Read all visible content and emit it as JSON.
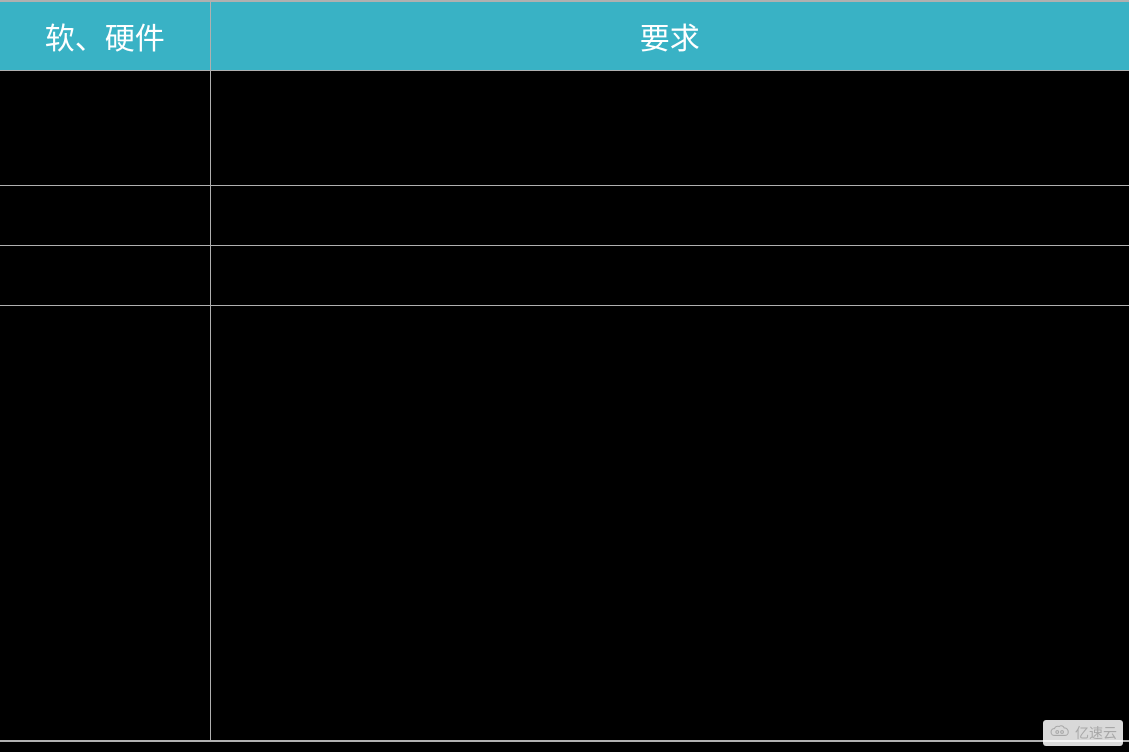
{
  "headers": {
    "col1": "软、硬件",
    "col2": "要求"
  },
  "rows": [
    {
      "col1": "",
      "col2": ""
    },
    {
      "col1": "",
      "col2": ""
    },
    {
      "col1": "",
      "col2": ""
    },
    {
      "col1": "",
      "col2": ""
    }
  ],
  "watermark": {
    "text": "亿速云"
  }
}
